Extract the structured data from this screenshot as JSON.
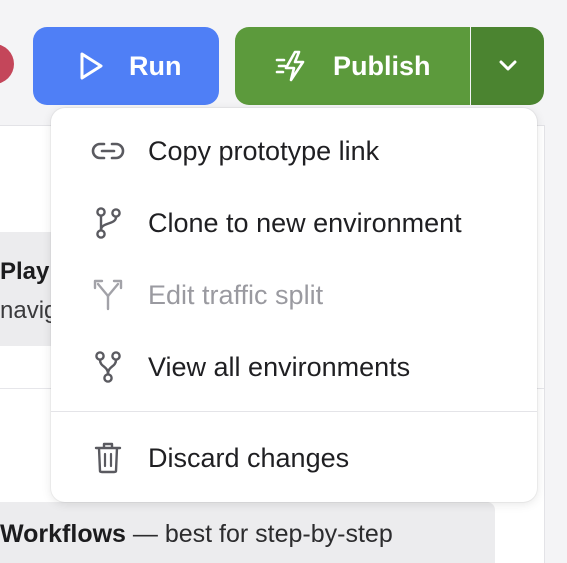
{
  "toolbar": {
    "run_label": "Run",
    "publish_label": "Publish",
    "run_color": "#4f7ff6",
    "publish_color": "#5c9a3c"
  },
  "menu": {
    "items": [
      {
        "label": "Copy prototype link",
        "icon": "link-icon",
        "disabled": false
      },
      {
        "label": "Clone to new environment",
        "icon": "git-branch-icon",
        "disabled": false
      },
      {
        "label": "Edit traffic split",
        "icon": "split-icon",
        "disabled": true
      },
      {
        "label": "View all environments",
        "icon": "git-fork-icon",
        "disabled": false
      },
      {
        "label": "Discard changes",
        "icon": "trash-icon",
        "disabled": false
      }
    ]
  },
  "background": {
    "card_title": "Play",
    "card_subtitle": "navig",
    "strip_bold": "Workflows",
    "strip_rest": " — best for step-by-step"
  }
}
